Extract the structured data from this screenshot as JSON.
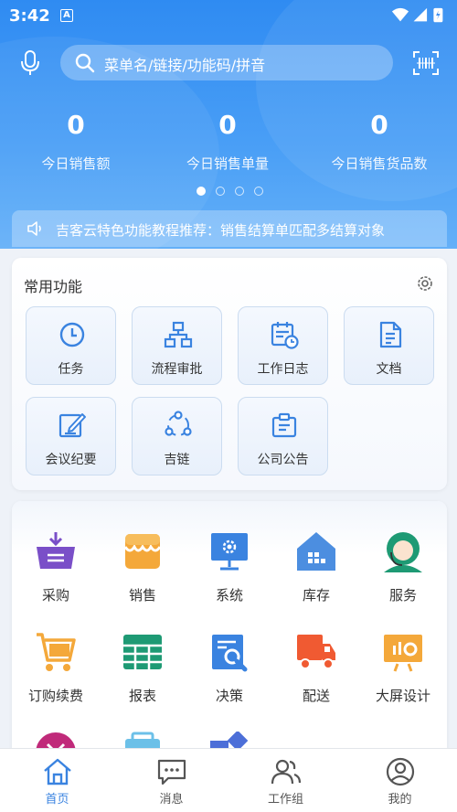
{
  "status_bar": {
    "time": "3:42",
    "notification_badge": "A"
  },
  "search": {
    "placeholder": "菜单名/链接/功能码/拼音"
  },
  "stats": [
    {
      "value": "0",
      "label": "今日销售额"
    },
    {
      "value": "0",
      "label": "今日销售单量"
    },
    {
      "value": "0",
      "label": "今日销售货品数"
    }
  ],
  "carousel": {
    "pages": 4,
    "active_page": 1
  },
  "notice": {
    "text": "吉客云特色功能教程推荐：销售结算单匹配多结算对象"
  },
  "common_functions": {
    "title": "常用功能",
    "items": [
      {
        "label": "任务",
        "icon": "clock-icon"
      },
      {
        "label": "流程审批",
        "icon": "flowchart-icon"
      },
      {
        "label": "工作日志",
        "icon": "calendar-log-icon"
      },
      {
        "label": "文档",
        "icon": "document-icon"
      },
      {
        "label": "会议纪要",
        "icon": "edit-note-icon"
      },
      {
        "label": "吉链",
        "icon": "share-icon"
      },
      {
        "label": "公司公告",
        "icon": "announcement-icon"
      }
    ]
  },
  "modules": {
    "items": [
      {
        "label": "采购",
        "icon": "purchase-icon"
      },
      {
        "label": "销售",
        "icon": "sales-store-icon"
      },
      {
        "label": "系统",
        "icon": "system-monitor-icon"
      },
      {
        "label": "库存",
        "icon": "warehouse-icon"
      },
      {
        "label": "服务",
        "icon": "customer-service-icon"
      },
      {
        "label": "订购续费",
        "icon": "shopping-cart-icon"
      },
      {
        "label": "报表",
        "icon": "report-table-icon"
      },
      {
        "label": "决策",
        "icon": "decision-search-icon"
      },
      {
        "label": "配送",
        "icon": "delivery-truck-icon"
      },
      {
        "label": "大屏设计",
        "icon": "big-screen-icon"
      }
    ]
  },
  "tabbar": {
    "items": [
      {
        "label": "首页",
        "icon": "home-icon",
        "active": true
      },
      {
        "label": "消息",
        "icon": "message-icon",
        "active": false
      },
      {
        "label": "工作组",
        "icon": "group-icon",
        "active": false
      },
      {
        "label": "我的",
        "icon": "profile-icon",
        "active": false
      }
    ]
  },
  "colors": {
    "header_blue": "#2f8bf2",
    "icon_blue": "#3a83e0",
    "accent_orange": "#f4a83a",
    "accent_green": "#1e9a74",
    "accent_purple": "#7a4fc8",
    "accent_red": "#f05a32"
  }
}
